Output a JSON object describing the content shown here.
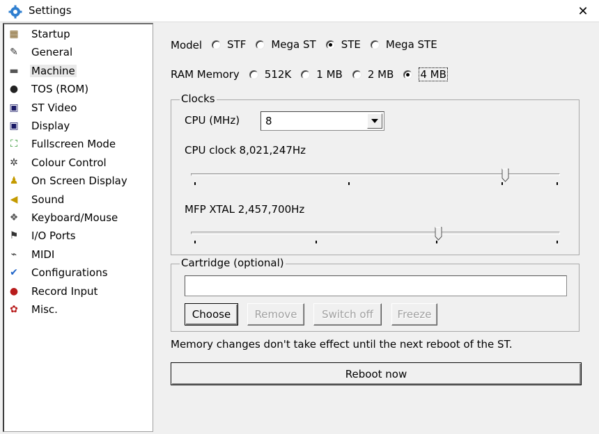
{
  "window": {
    "title": "Settings",
    "close_glyph": "✕"
  },
  "sidebar": {
    "items": [
      {
        "label": "Startup",
        "icon": "startup-icon",
        "glyph": "▦",
        "color": "#7b5a1e"
      },
      {
        "label": "General",
        "icon": "pencil-icon",
        "glyph": "✎",
        "color": "#333333"
      },
      {
        "label": "Machine",
        "icon": "machine-icon",
        "glyph": "▬",
        "color": "#555555",
        "selected": true
      },
      {
        "label": "TOS (ROM)",
        "icon": "tos-chip-icon",
        "glyph": "●",
        "color": "#222222"
      },
      {
        "label": "ST Video",
        "icon": "monitor-icon",
        "glyph": "▣",
        "color": "#1a1a66"
      },
      {
        "label": "Display",
        "icon": "display-icon",
        "glyph": "▣",
        "color": "#1a1a66"
      },
      {
        "label": "Fullscreen Mode",
        "icon": "fullscreen-icon",
        "glyph": "⛶",
        "color": "#1b8a1b"
      },
      {
        "label": "Colour Control",
        "icon": "colour-control-icon",
        "glyph": "✲",
        "color": "#333333"
      },
      {
        "label": "On Screen Display",
        "icon": "osd-icon",
        "glyph": "♟",
        "color": "#c49a00"
      },
      {
        "label": "Sound",
        "icon": "speaker-icon",
        "glyph": "◀",
        "color": "#c49a00"
      },
      {
        "label": "Keyboard/Mouse",
        "icon": "mouse-icon",
        "glyph": "❖",
        "color": "#555555"
      },
      {
        "label": "I/O Ports",
        "icon": "ports-icon",
        "glyph": "⚑",
        "color": "#333333"
      },
      {
        "label": "MIDI",
        "icon": "midi-icon",
        "glyph": "⌁",
        "color": "#333333"
      },
      {
        "label": "Configurations",
        "icon": "wrench-icon",
        "glyph": "✔",
        "color": "#1e64c8"
      },
      {
        "label": "Record Input",
        "icon": "record-icon",
        "glyph": "●",
        "color": "#b81c1c"
      },
      {
        "label": "Misc.",
        "icon": "misc-icon",
        "glyph": "✿",
        "color": "#b81c1c"
      }
    ]
  },
  "machine": {
    "model_label": "Model",
    "models": [
      {
        "label": "STF",
        "checked": false
      },
      {
        "label": "Mega ST",
        "checked": false
      },
      {
        "label": "STE",
        "checked": true
      },
      {
        "label": "Mega STE",
        "checked": false
      }
    ],
    "ram_label": "RAM Memory",
    "ram_options": [
      {
        "label": "512K",
        "checked": false
      },
      {
        "label": "1 MB",
        "checked": false
      },
      {
        "label": "2 MB",
        "checked": false
      },
      {
        "label": "4 MB",
        "checked": true
      }
    ],
    "clocks": {
      "group_label": "Clocks",
      "cpu_label": "CPU (MHz)",
      "cpu_value": "8",
      "cpu_clock_text": "CPU clock 8,021,247Hz",
      "cpu_clock_level": 0.85,
      "mfp_text": "MFP XTAL 2,457,700Hz",
      "mfp_level": 0.67
    },
    "cartridge": {
      "group_label": "Cartridge (optional)",
      "path_value": "",
      "choose_label": "Choose",
      "remove_label": "Remove",
      "switch_off_label": "Switch off",
      "freeze_label": "Freeze"
    },
    "note": "Memory changes don't take effect until the next reboot of the ST.",
    "reboot_label": "Reboot now"
  }
}
